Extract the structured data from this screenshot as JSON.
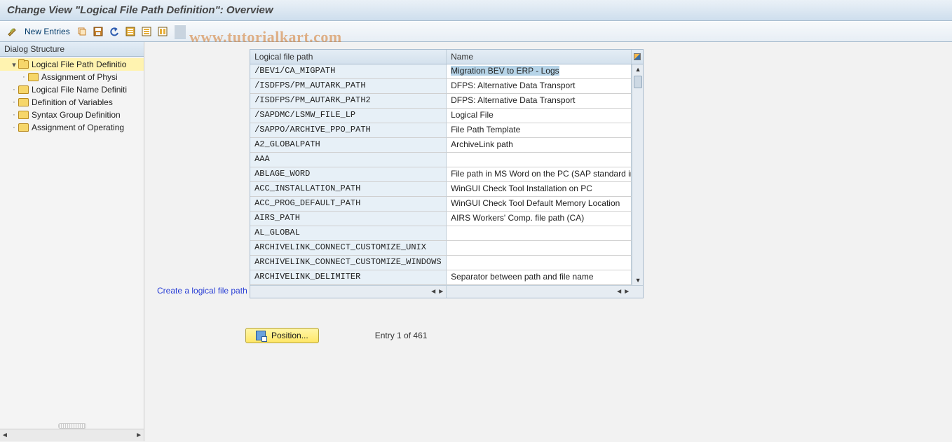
{
  "title": "Change View \"Logical File Path Definition\": Overview",
  "watermark": "www.tutorialkart.com",
  "toolbar": {
    "new_entries": "New Entries"
  },
  "sidebar": {
    "header": "Dialog Structure",
    "items": [
      {
        "label": "Logical File Path Definitio",
        "indent": 1,
        "open": true,
        "exp": "▾",
        "selected": true
      },
      {
        "label": "Assignment of Physi",
        "indent": 2,
        "open": false,
        "exp": "·"
      },
      {
        "label": "Logical File Name Definiti",
        "indent": 1,
        "open": false,
        "exp": "·"
      },
      {
        "label": "Definition of Variables",
        "indent": 1,
        "open": false,
        "exp": "·"
      },
      {
        "label": "Syntax Group Definition",
        "indent": 1,
        "open": false,
        "exp": "·"
      },
      {
        "label": "Assignment of Operating",
        "indent": 1,
        "open": false,
        "exp": "·"
      }
    ]
  },
  "content": {
    "create_link": "Create a logical file path",
    "columns": {
      "path": "Logical file path",
      "name": "Name"
    },
    "rows": [
      {
        "path": "/BEV1/CA_MIGPATH",
        "name": "Migration BEV to ERP - Logs",
        "selected": true
      },
      {
        "path": "/ISDFPS/PM_AUTARK_PATH",
        "name": "DFPS: Alternative Data Transport"
      },
      {
        "path": "/ISDFPS/PM_AUTARK_PATH2",
        "name": "DFPS: Alternative Data Transport"
      },
      {
        "path": "/SAPDMC/LSMW_FILE_LP",
        "name": "Logical File"
      },
      {
        "path": "/SAPPO/ARCHIVE_PPO_PATH",
        "name": "File Path Template"
      },
      {
        "path": "A2_GLOBALPATH",
        "name": "ArchiveLink path"
      },
      {
        "path": "AAA",
        "name": ""
      },
      {
        "path": "ABLAGE_WORD",
        "name": "File path in MS Word on the PC (SAP standard in"
      },
      {
        "path": "ACC_INSTALLATION_PATH",
        "name": "WinGUI Check Tool Installation on PC"
      },
      {
        "path": "ACC_PROG_DEFAULT_PATH",
        "name": "WinGUI Check Tool Default Memory Location"
      },
      {
        "path": "AIRS_PATH",
        "name": "AIRS Workers' Comp. file path (CA)"
      },
      {
        "path": "AL_GLOBAL",
        "name": ""
      },
      {
        "path": "ARCHIVELINK_CONNECT_CUSTOMIZE_UNIX",
        "name": ""
      },
      {
        "path": "ARCHIVELINK_CONNECT_CUSTOMIZE_WINDOWS",
        "name": ""
      },
      {
        "path": "ARCHIVELINK_DELIMITER",
        "name": "Separator between path and file name"
      }
    ]
  },
  "footer": {
    "position": "Position...",
    "entry": "Entry 1 of 461"
  }
}
